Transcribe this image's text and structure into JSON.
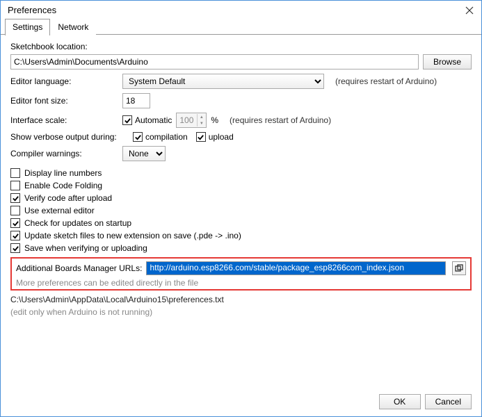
{
  "window": {
    "title": "Preferences"
  },
  "tabs": {
    "settings": "Settings",
    "network": "Network"
  },
  "sketchbook": {
    "label": "Sketchbook location:",
    "path": "C:\\Users\\Admin\\Documents\\Arduino",
    "browse": "Browse"
  },
  "editorLanguage": {
    "label": "Editor language:",
    "value": "System Default",
    "note": "(requires restart of Arduino)"
  },
  "editorFontSize": {
    "label": "Editor font size:",
    "value": "18"
  },
  "interfaceScale": {
    "label": "Interface scale:",
    "automatic": "Automatic",
    "percent": "100",
    "percentSuffix": "%",
    "note": "(requires restart of Arduino)"
  },
  "verbose": {
    "label": "Show verbose output during:",
    "compilation": "compilation",
    "upload": "upload"
  },
  "compilerWarnings": {
    "label": "Compiler warnings:",
    "value": "None"
  },
  "checks": {
    "displayLineNumbers": "Display line numbers",
    "enableCodeFolding": "Enable Code Folding",
    "verifyAfterUpload": "Verify code after upload",
    "useExternalEditor": "Use external editor",
    "checkUpdates": "Check for updates on startup",
    "updateSketch": "Update sketch files to new extension on save (.pde -> .ino)",
    "saveWhenVerifying": "Save when verifying or uploading"
  },
  "boardsUrls": {
    "label": "Additional Boards Manager URLs:",
    "value": "http://arduino.esp8266.com/stable/package_esp8266com_index.json"
  },
  "moreNote": "More preferences can be edited directly in the file",
  "prefPath": "C:\\Users\\Admin\\AppData\\Local\\Arduino15\\preferences.txt",
  "editOnlyNote": "(edit only when Arduino is not running)",
  "buttons": {
    "ok": "OK",
    "cancel": "Cancel"
  }
}
